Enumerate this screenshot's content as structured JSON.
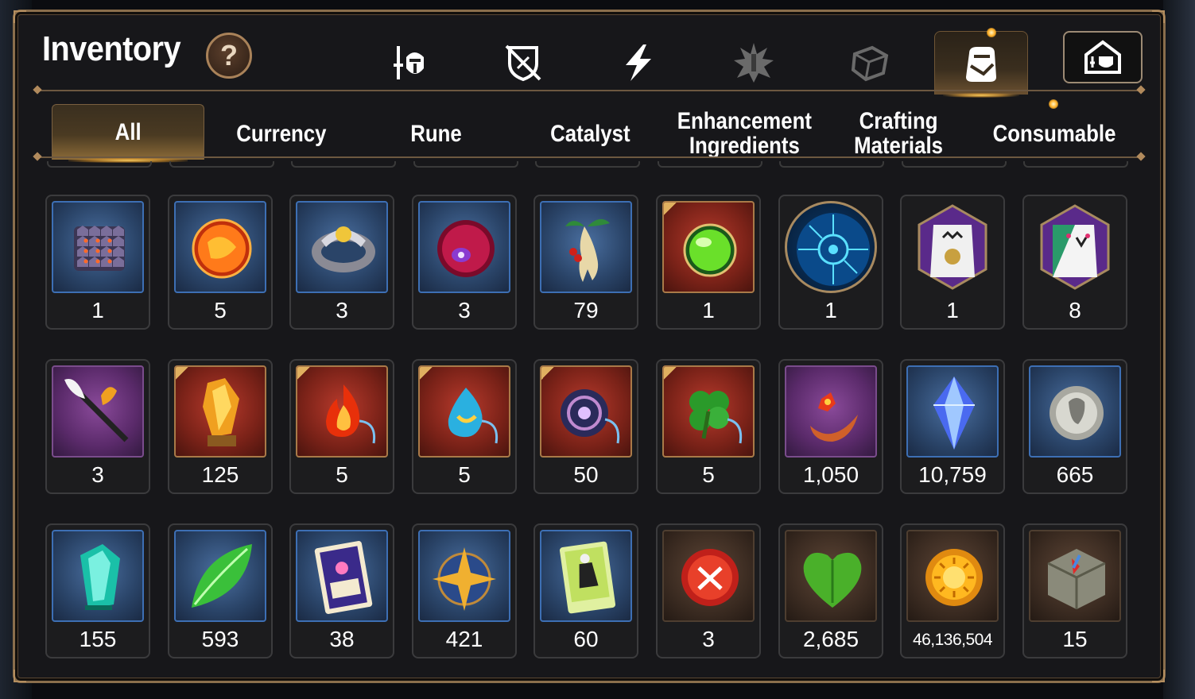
{
  "window": {
    "title": "Inventory",
    "help_symbol": "?"
  },
  "category_tabs": [
    {
      "icon": "knight-sword-icon",
      "active": false
    },
    {
      "icon": "broken-shield-icon",
      "active": false
    },
    {
      "icon": "lightning-icon",
      "active": false
    },
    {
      "icon": "spiky-emblem-icon",
      "active": false
    },
    {
      "icon": "cube-icon",
      "active": false
    },
    {
      "icon": "backpack-icon",
      "active": true
    }
  ],
  "storage_button": {
    "icon": "storage-castle-icon"
  },
  "subtabs": [
    {
      "label": "All",
      "active": true
    },
    {
      "label": "Currency",
      "active": false
    },
    {
      "label": "Rune",
      "active": false
    },
    {
      "label": "Catalyst",
      "active": false
    },
    {
      "label": "Enhancement\nIngredients",
      "active": false
    },
    {
      "label": "Crafting\nMaterials",
      "active": false
    },
    {
      "label": "Consumable",
      "active": false
    }
  ],
  "items": [
    {
      "icon": "scale-armor-icon",
      "rarity": "blue",
      "count": "1"
    },
    {
      "icon": "fire-orb-icon",
      "rarity": "blue",
      "count": "5"
    },
    {
      "icon": "silver-ring-icon",
      "rarity": "blue",
      "count": "3"
    },
    {
      "icon": "crimson-eye-orb-icon",
      "rarity": "blue",
      "count": "3"
    },
    {
      "icon": "ginseng-root-icon",
      "rarity": "blue",
      "count": "79"
    },
    {
      "icon": "green-potion-icon",
      "rarity": "red",
      "count": "1"
    },
    {
      "icon": "blue-rune-disc-icon",
      "rarity": "round",
      "count": "1"
    },
    {
      "icon": "pet-food-bag-icon",
      "rarity": "hex",
      "count": "1"
    },
    {
      "icon": "pet-snack-bag-icon",
      "rarity": "hex",
      "count": "8"
    },
    {
      "icon": "feather-wand-icon",
      "rarity": "purple",
      "count": "3"
    },
    {
      "icon": "amber-crystal-icon",
      "rarity": "red",
      "count": "125"
    },
    {
      "icon": "fire-charm-icon",
      "rarity": "red",
      "count": "5"
    },
    {
      "icon": "water-charm-icon",
      "rarity": "red",
      "count": "5"
    },
    {
      "icon": "dark-charm-icon",
      "rarity": "red",
      "count": "50"
    },
    {
      "icon": "clover-charm-icon",
      "rarity": "red",
      "count": "5"
    },
    {
      "icon": "flower-crescent-icon",
      "rarity": "purple",
      "count": "1,050"
    },
    {
      "icon": "blue-diamond-icon",
      "rarity": "blue",
      "count": "10,759"
    },
    {
      "icon": "silver-coin-icon",
      "rarity": "blue",
      "count": "665"
    },
    {
      "icon": "teal-crystal-icon",
      "rarity": "blue",
      "count": "155"
    },
    {
      "icon": "green-leaf-icon",
      "rarity": "blue",
      "count": "593"
    },
    {
      "icon": "purple-card-icon",
      "rarity": "blue",
      "count": "38"
    },
    {
      "icon": "star-compass-icon",
      "rarity": "blue",
      "count": "421"
    },
    {
      "icon": "costume-card-icon",
      "rarity": "blue",
      "count": "60"
    },
    {
      "icon": "red-badge-icon",
      "rarity": "brown",
      "count": "3"
    },
    {
      "icon": "green-heart-icon",
      "rarity": "brown",
      "count": "2,685"
    },
    {
      "icon": "sun-coin-icon",
      "rarity": "brown",
      "count": "46,136,504"
    },
    {
      "icon": "stone-compass-icon",
      "rarity": "brown",
      "count": "15"
    }
  ],
  "colors": {
    "frame": "#8a6e4c",
    "accent_glow": "#ffce5a",
    "panel_bg": "#17171a",
    "text": "#ffffff"
  }
}
